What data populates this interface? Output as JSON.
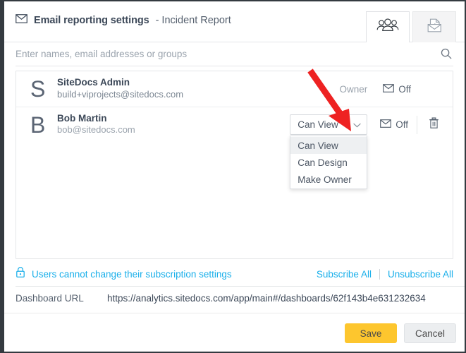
{
  "window": {
    "border_color": "#343a40"
  },
  "header": {
    "icon": "envelope-icon",
    "title": "Email reporting settings",
    "subtitle": "- Incident Report",
    "tabs": [
      {
        "name": "users-tab",
        "icon": "people-group-icon",
        "active": true
      },
      {
        "name": "report-tab",
        "icon": "envelope-chart-icon",
        "active": false
      }
    ]
  },
  "search": {
    "placeholder": "Enter names, email addresses or groups",
    "value": "",
    "icon": "search-icon"
  },
  "users": [
    {
      "initial": "S",
      "name": "SiteDocs Admin",
      "email": "build+viprojects@sitedocs.com",
      "role_label": "Owner",
      "role_is_static": true,
      "subscription_icon": "envelope-icon",
      "subscription_label": "Off",
      "deletable": false
    },
    {
      "initial": "B",
      "name": "Bob Martin",
      "email": "bob@sitedocs.com",
      "role_label": "Can View",
      "role_is_static": false,
      "subscription_icon": "envelope-icon",
      "subscription_label": "Off",
      "deletable": true,
      "delete_icon": "trash-icon"
    }
  ],
  "role_dropdown": {
    "open": true,
    "selected": "Can View",
    "chevron_icon": "chevron-down-icon",
    "options": [
      {
        "label": "Can View",
        "selected": true
      },
      {
        "label": "Can Design",
        "selected": false
      },
      {
        "label": "Make Owner",
        "selected": false
      }
    ]
  },
  "subscription_bar": {
    "lock_icon": "lock-icon",
    "message": "Users cannot change their subscription settings",
    "subscribe_all": "Subscribe All",
    "unsubscribe_all": "Unsubscribe All",
    "link_color": "#19afea"
  },
  "dashboard_url": {
    "label": "Dashboard URL",
    "value": "https://analytics.sitedocs.com/app/main#/dashboards/62f143b4e631232634"
  },
  "footer": {
    "save_label": "Save",
    "cancel_label": "Cancel",
    "save_color": "#fdc62e",
    "cancel_color": "#eceef0"
  },
  "annotation": {
    "arrow_color": "#ee2222",
    "name": "red-pointer-arrow"
  }
}
